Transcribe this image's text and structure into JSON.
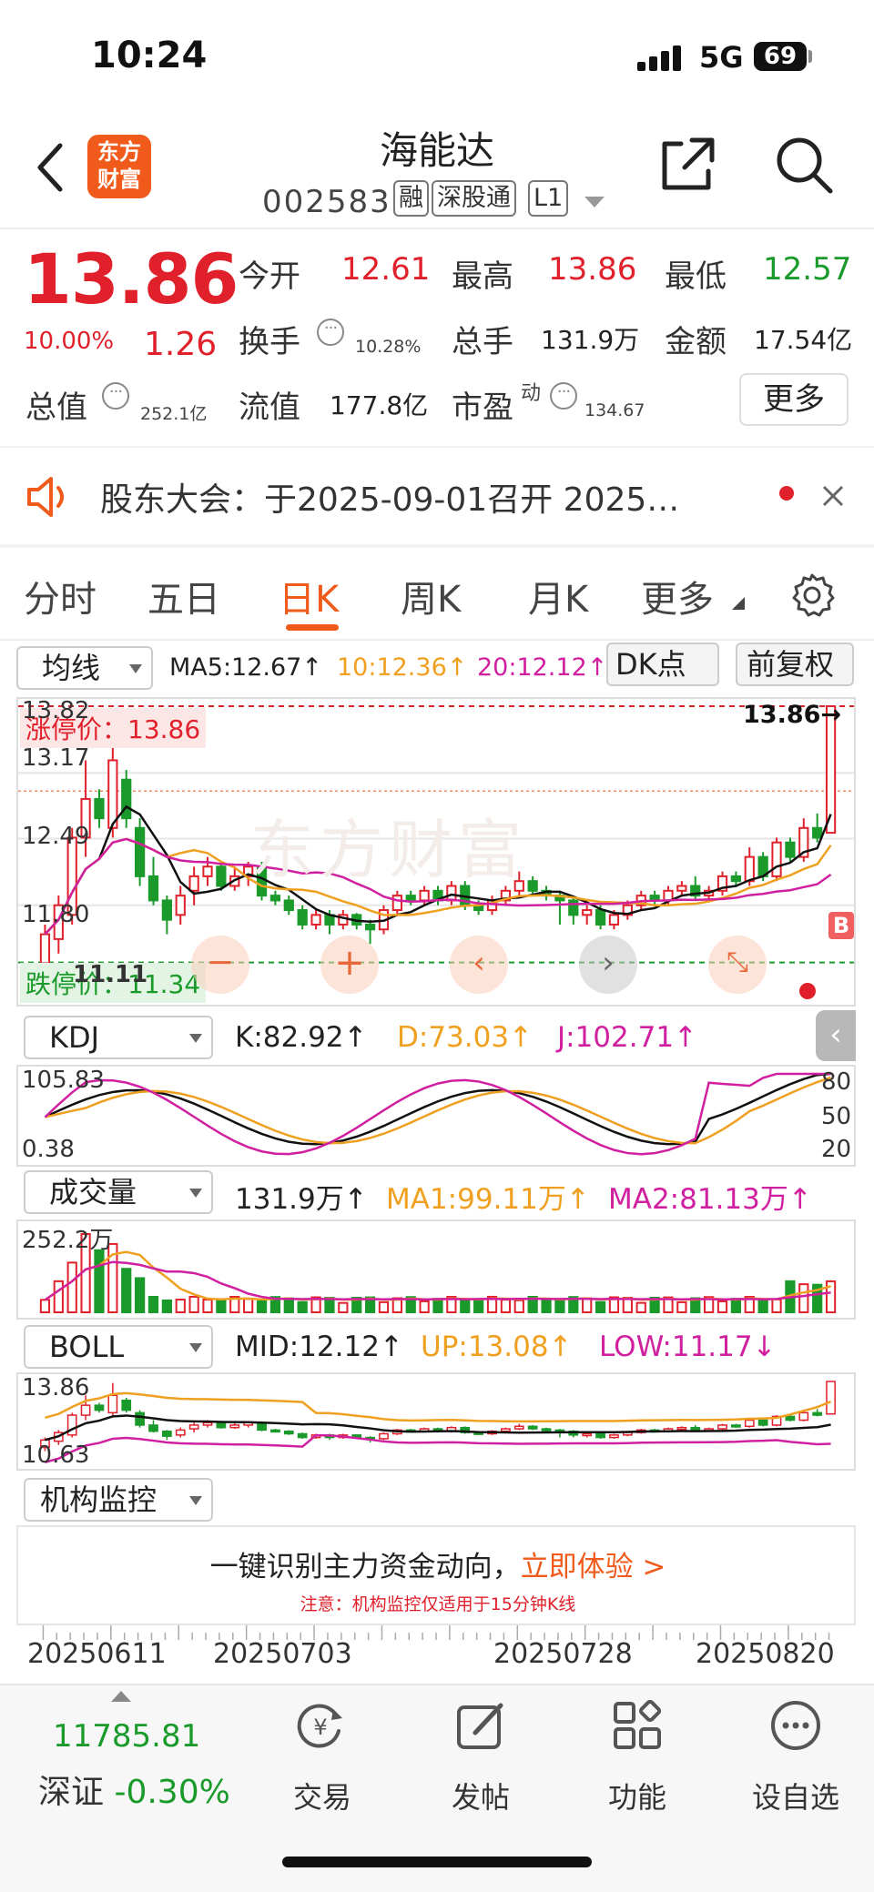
{
  "status": {
    "time": "10:24",
    "network": "5G",
    "battery": "69"
  },
  "header": {
    "title": "海能达",
    "code": "002583",
    "tags": [
      "融",
      "深股通",
      "L1"
    ]
  },
  "quote": {
    "price": "13.86",
    "change_pct": "10.00%",
    "change": "1.26",
    "open_label": "今开",
    "open": "12.61",
    "high_label": "最高",
    "high": "13.86",
    "low_label": "最低",
    "low": "12.57",
    "turnover_label": "换手",
    "turnover": "10.28%",
    "volume_label": "总手",
    "volume": "131.9万",
    "amount_label": "金额",
    "amount": "17.54亿",
    "mktcap_label": "总值",
    "mktcap": "252.1亿",
    "float_label": "流值",
    "float": "177.8亿",
    "pe_label": "市盈",
    "pe_sup": "动",
    "pe": "134.67",
    "more_button": "更多"
  },
  "notice": {
    "text": "股东大会：于2025-09-01召开 2025…"
  },
  "tabs": [
    "分时",
    "五日",
    "日K",
    "周K",
    "月K",
    "更多"
  ],
  "kchart": {
    "ma_select": "均线",
    "ma5": "MA5:12.67↑",
    "ma10": "10:12.36↑",
    "ma20": "20:12.12↑",
    "dk_button": "DK点",
    "adjust_button": "前复权",
    "limit_up_label": "涨停价：13.86",
    "limit_down_label": "跌停价：11.34",
    "axis_top": "13.82",
    "axis_1": "13.17",
    "axis_2": "12.49",
    "axis_3": "11.80",
    "axis_bottom": "11.11",
    "last_price_label": "13.86→",
    "b_mark": "B",
    "watermark": "东方财富"
  },
  "kdj": {
    "select": "KDJ",
    "k": "K:82.92↑",
    "d": "D:73.03↑",
    "j": "J:102.71↑",
    "axis_top": "105.83",
    "axis_bottom": "0.38",
    "r80": "80",
    "r50": "50",
    "r20": "20"
  },
  "vol": {
    "select": "成交量",
    "v": "131.9万↑",
    "ma1": "MA1:99.11万↑",
    "ma2": "MA2:81.13万↑",
    "axis_top": "252.2万"
  },
  "boll": {
    "select": "BOLL",
    "mid": "MID:12.12↑",
    "up": "UP:13.08↑",
    "low": "LOW:11.17↓",
    "axis_top": "13.86",
    "axis_bottom": "10.63"
  },
  "inst": {
    "select": "机构监控",
    "ad_main": "一键识别主力资金动向，",
    "ad_link": "立即体验 >",
    "ad_note": "注意：机构监控仅适用于15分钟K线"
  },
  "dates": [
    "20250611",
    "20250703",
    "20250728",
    "20250820"
  ],
  "bottom": {
    "index_value": "11785.81",
    "index_name": "深证",
    "index_change": "-0.30%",
    "items": [
      "交易",
      "发帖",
      "功能",
      "设自选"
    ]
  },
  "colors": {
    "up": "#e0202a",
    "down": "#1a9a2a",
    "accent": "#f05a1a",
    "ma5": "#111111",
    "ma10": "#f0a020",
    "ma20": "#d020a0"
  },
  "candles": [
    [
      11.2,
      11.5,
      11.05,
      11.6
    ],
    [
      11.45,
      11.8,
      11.3,
      11.9
    ],
    [
      11.7,
      12.5,
      11.6,
      12.6
    ],
    [
      12.5,
      12.9,
      12.3,
      13.3
    ],
    [
      12.9,
      12.7,
      12.6,
      13.0
    ],
    [
      12.6,
      13.3,
      12.5,
      13.8
    ],
    [
      13.1,
      12.7,
      12.6,
      13.2
    ],
    [
      12.6,
      12.1,
      12.0,
      12.7
    ],
    [
      12.1,
      11.85,
      11.8,
      12.3
    ],
    [
      11.85,
      11.65,
      11.5,
      11.9
    ],
    [
      11.7,
      11.9,
      11.6,
      12.0
    ],
    [
      11.95,
      12.1,
      11.8,
      12.2
    ],
    [
      12.1,
      12.2,
      12.0,
      12.3
    ],
    [
      12.2,
      12.0,
      11.95,
      12.25
    ],
    [
      12.0,
      12.1,
      11.95,
      12.2
    ],
    [
      12.1,
      12.2,
      12.0,
      12.25
    ],
    [
      12.2,
      11.9,
      11.85,
      12.25
    ],
    [
      11.9,
      11.85,
      11.8,
      11.95
    ],
    [
      11.85,
      11.75,
      11.7,
      11.9
    ],
    [
      11.75,
      11.6,
      11.55,
      11.8
    ],
    [
      11.6,
      11.7,
      11.55,
      11.75
    ],
    [
      11.7,
      11.6,
      11.5,
      11.75
    ],
    [
      11.6,
      11.7,
      11.55,
      11.75
    ],
    [
      11.7,
      11.6,
      11.55,
      11.72
    ],
    [
      11.6,
      11.55,
      11.4,
      11.65
    ],
    [
      11.55,
      11.75,
      11.5,
      11.8
    ],
    [
      11.75,
      11.9,
      11.7,
      11.95
    ],
    [
      11.9,
      11.85,
      11.8,
      11.95
    ],
    [
      11.85,
      11.95,
      11.8,
      12.0
    ],
    [
      11.95,
      11.85,
      11.8,
      12.0
    ],
    [
      11.85,
      12.0,
      11.8,
      12.05
    ],
    [
      12.0,
      11.8,
      11.75,
      12.05
    ],
    [
      11.8,
      11.75,
      11.7,
      11.85
    ],
    [
      11.75,
      11.85,
      11.7,
      11.9
    ],
    [
      11.85,
      11.95,
      11.8,
      12.0
    ],
    [
      11.95,
      12.05,
      11.9,
      12.15
    ],
    [
      12.05,
      11.95,
      11.9,
      12.1
    ],
    [
      11.95,
      11.9,
      11.85,
      12.0
    ],
    [
      11.9,
      11.85,
      11.6,
      11.95
    ],
    [
      11.85,
      11.7,
      11.6,
      11.9
    ],
    [
      11.7,
      11.75,
      11.6,
      11.8
    ],
    [
      11.75,
      11.6,
      11.55,
      11.8
    ],
    [
      11.6,
      11.7,
      11.55,
      11.75
    ],
    [
      11.7,
      11.8,
      11.65,
      11.85
    ],
    [
      11.8,
      11.9,
      11.75,
      11.95
    ],
    [
      11.9,
      11.85,
      11.8,
      11.95
    ],
    [
      11.85,
      11.95,
      11.8,
      12.0
    ],
    [
      11.95,
      12.0,
      11.9,
      12.05
    ],
    [
      12.0,
      11.9,
      11.85,
      12.1
    ],
    [
      11.9,
      11.95,
      11.85,
      12.0
    ],
    [
      11.95,
      12.1,
      11.9,
      12.15
    ],
    [
      12.1,
      12.05,
      12.0,
      12.15
    ],
    [
      12.05,
      12.3,
      12.0,
      12.4
    ],
    [
      12.3,
      12.1,
      12.05,
      12.35
    ],
    [
      12.1,
      12.45,
      12.05,
      12.5
    ],
    [
      12.45,
      12.3,
      12.25,
      12.5
    ],
    [
      12.3,
      12.6,
      12.25,
      12.7
    ],
    [
      12.6,
      12.5,
      12.45,
      12.75
    ],
    [
      12.55,
      13.86,
      12.57,
      13.86
    ]
  ]
}
